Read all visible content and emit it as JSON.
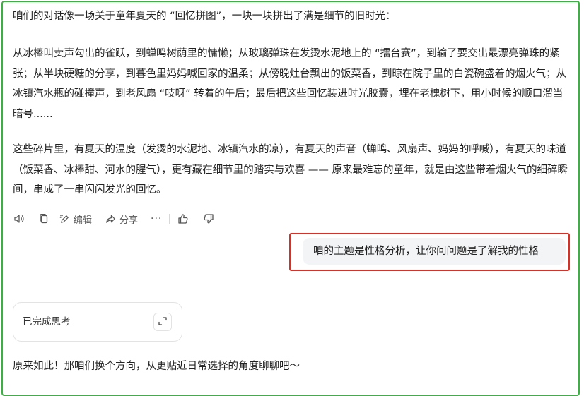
{
  "assistant_message": {
    "paragraph_1": "咱们的对话像一场关于童年夏天的 “回忆拼图”，一块一块拼出了满是细节的旧时光：",
    "paragraph_2": "从冰棒叫卖声勾出的雀跃，到蝉鸣树荫里的慵懒；从玻璃弹珠在发烫水泥地上的 “擂台赛”，到输了要交出最漂亮弹珠的紧张；从半块硬糖的分享，到暮色里妈妈喊回家的温柔；从傍晚灶台飘出的饭菜香，到晾在院子里的白瓷碗盛着的烟火气；从冰镇汽水瓶的碰撞声，到老风扇 “吱呀” 转着的午后；最后把这些回忆装进时光胶囊，埋在老槐树下，用小时候的顺口溜当暗号......",
    "paragraph_3": "这些碎片里，有夏天的温度（发烫的水泥地、冰镇汽水的凉），有夏天的声音（蝉鸣、风扇声、妈妈的呼喊），有夏天的味道（饭菜香、冰棒甜、河水的腥气），更有藏在细节里的踏实与欢喜 —— 原来最难忘的童年，就是由这些带着烟火气的细碎瞬间，串成了一串闪闪发光的回忆。"
  },
  "message_actions": {
    "read_aloud_icon": "speaker-icon",
    "copy_icon": "copy-icon",
    "edit_label": "编辑",
    "share_label": "分享",
    "more_label": "···",
    "like_icon": "thumbs-up-icon",
    "dislike_icon": "thumbs-down-icon"
  },
  "user_message": {
    "text": "咱的主题是性格分析，让你问问题是了解我的性格"
  },
  "thinking_card": {
    "label": "已完成思考",
    "expand_icon": "expand-icon"
  },
  "assistant_reply": {
    "text": "原来如此！那咱们换个方向，从更贴近日常选择的角度聊聊吧～"
  },
  "colors": {
    "frame_border": "#3cb043",
    "highlight_border": "#d93025",
    "user_bubble_bg": "#f3f4f6",
    "text": "#222222"
  }
}
